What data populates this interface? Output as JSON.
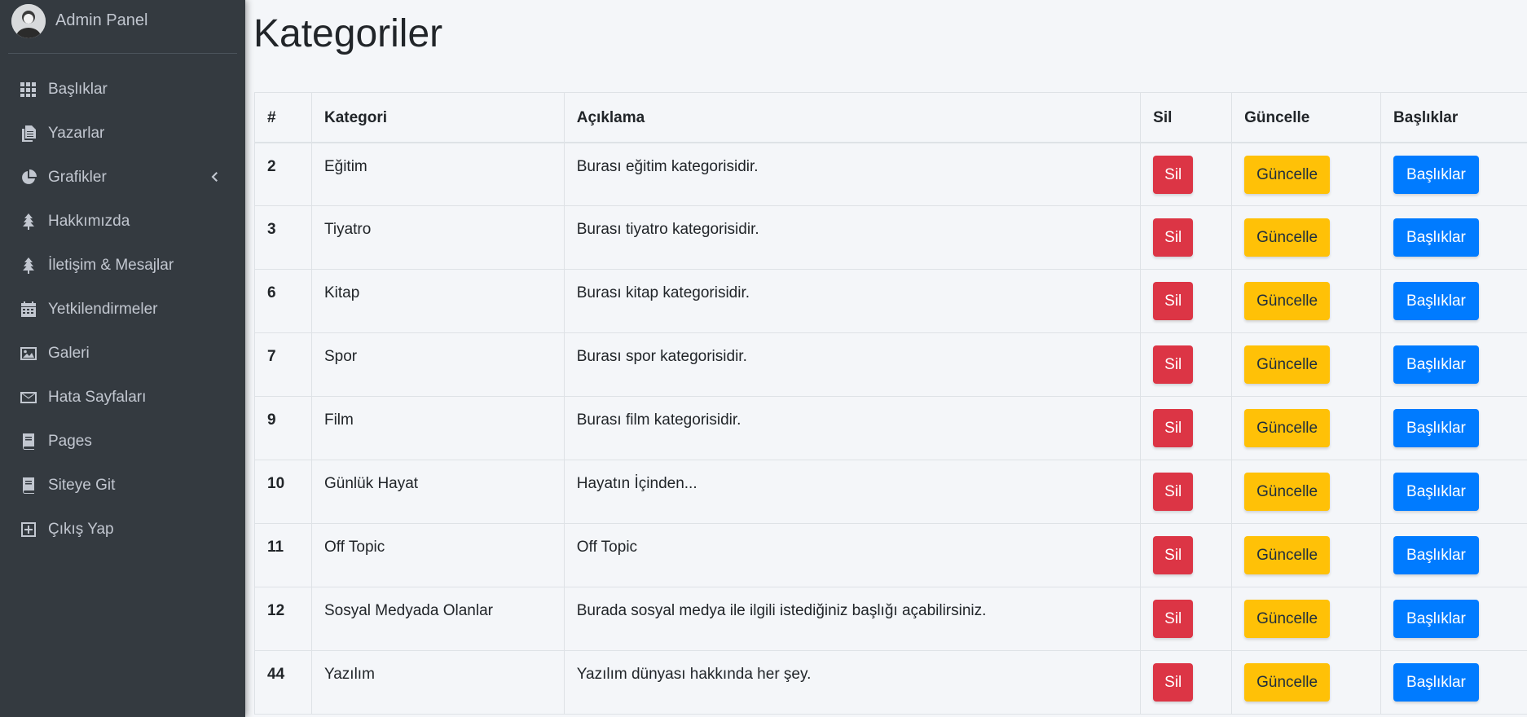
{
  "brand": {
    "title": "Admin Panel"
  },
  "sidebar": {
    "items": [
      {
        "label": "Başlıklar",
        "icon": "grid-icon"
      },
      {
        "label": "Yazarlar",
        "icon": "copy-icon"
      },
      {
        "label": "Grafikler",
        "icon": "pie-chart-icon",
        "has_caret": true
      },
      {
        "label": "Hakkımızda",
        "icon": "tree-icon"
      },
      {
        "label": "İletişim & Mesajlar",
        "icon": "tree-icon"
      },
      {
        "label": "Yetkilendirmeler",
        "icon": "calendar-icon"
      },
      {
        "label": "Galeri",
        "icon": "image-icon"
      },
      {
        "label": "Hata Sayfaları",
        "icon": "envelope-icon"
      },
      {
        "label": "Pages",
        "icon": "book-icon"
      },
      {
        "label": "Siteye Git",
        "icon": "book-icon"
      },
      {
        "label": "Çıkış Yap",
        "icon": "plus-square-icon"
      }
    ]
  },
  "page": {
    "title": "Kategoriler"
  },
  "table": {
    "headers": [
      "#",
      "Kategori",
      "Açıklama",
      "Sil",
      "Güncelle",
      "Başlıklar"
    ],
    "rows": [
      {
        "id": "2",
        "name": "Eğitim",
        "desc": "Burası eğitim kategorisidir."
      },
      {
        "id": "3",
        "name": "Tiyatro",
        "desc": "Burası tiyatro kategorisidir."
      },
      {
        "id": "6",
        "name": "Kitap",
        "desc": "Burası kitap kategorisidir."
      },
      {
        "id": "7",
        "name": "Spor",
        "desc": "Burası spor kategorisidir."
      },
      {
        "id": "9",
        "name": "Film",
        "desc": "Burası film kategorisidir."
      },
      {
        "id": "10",
        "name": "Günlük Hayat",
        "desc": "Hayatın İçinden..."
      },
      {
        "id": "11",
        "name": "Off Topic",
        "desc": "Off Topic"
      },
      {
        "id": "12",
        "name": "Sosyal Medyada Olanlar",
        "desc": "Burada sosyal medya ile ilgili istediğiniz başlığı açabilirsiniz."
      },
      {
        "id": "44",
        "name": "Yazılım",
        "desc": "Yazılım dünyası hakkında her şey."
      }
    ],
    "buttons": {
      "delete": "Sil",
      "update": "Güncelle",
      "titles": "Başlıklar"
    }
  },
  "colors": {
    "sidebar_bg": "#343a40",
    "danger": "#dc3545",
    "warning": "#ffc107",
    "primary": "#007bff"
  }
}
